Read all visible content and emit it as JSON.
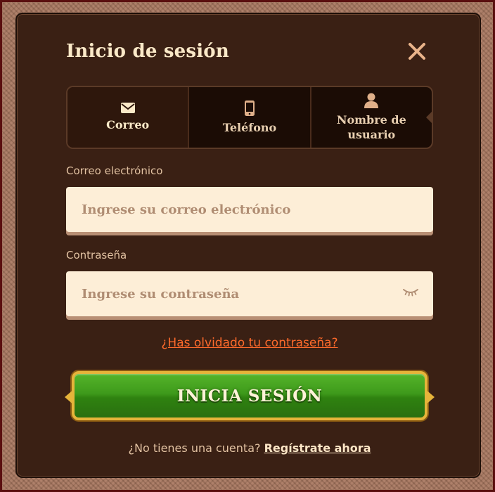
{
  "modal": {
    "title": "Inicio de sesión",
    "close_icon": "close-icon"
  },
  "tabs": [
    {
      "label": "Correo",
      "icon": "envelope-icon",
      "active": true
    },
    {
      "label": "Teléfono",
      "icon": "phone-icon",
      "active": false
    },
    {
      "label": "Nombre de usuario",
      "icon": "user-icon",
      "active": false
    }
  ],
  "email": {
    "label": "Correo electrónico",
    "placeholder": "Ingrese su correo electrónico",
    "value": ""
  },
  "password": {
    "label": "Contraseña",
    "placeholder": "Ingrese su contraseña",
    "value": "",
    "toggle_icon": "eye-closed-icon"
  },
  "forgot_link": "¿Has olvidado tu contraseña?",
  "login_button": "INICIA SESIÓN",
  "signup": {
    "prompt": "¿No tienes una cuenta?",
    "link": "Regístrate ahora"
  },
  "colors": {
    "modal_bg": "#3a2014",
    "accent_orange": "#ff6a2b",
    "button_green": "#3e9a1b",
    "button_border": "#e6b43a",
    "input_bg": "#fdeed7"
  }
}
